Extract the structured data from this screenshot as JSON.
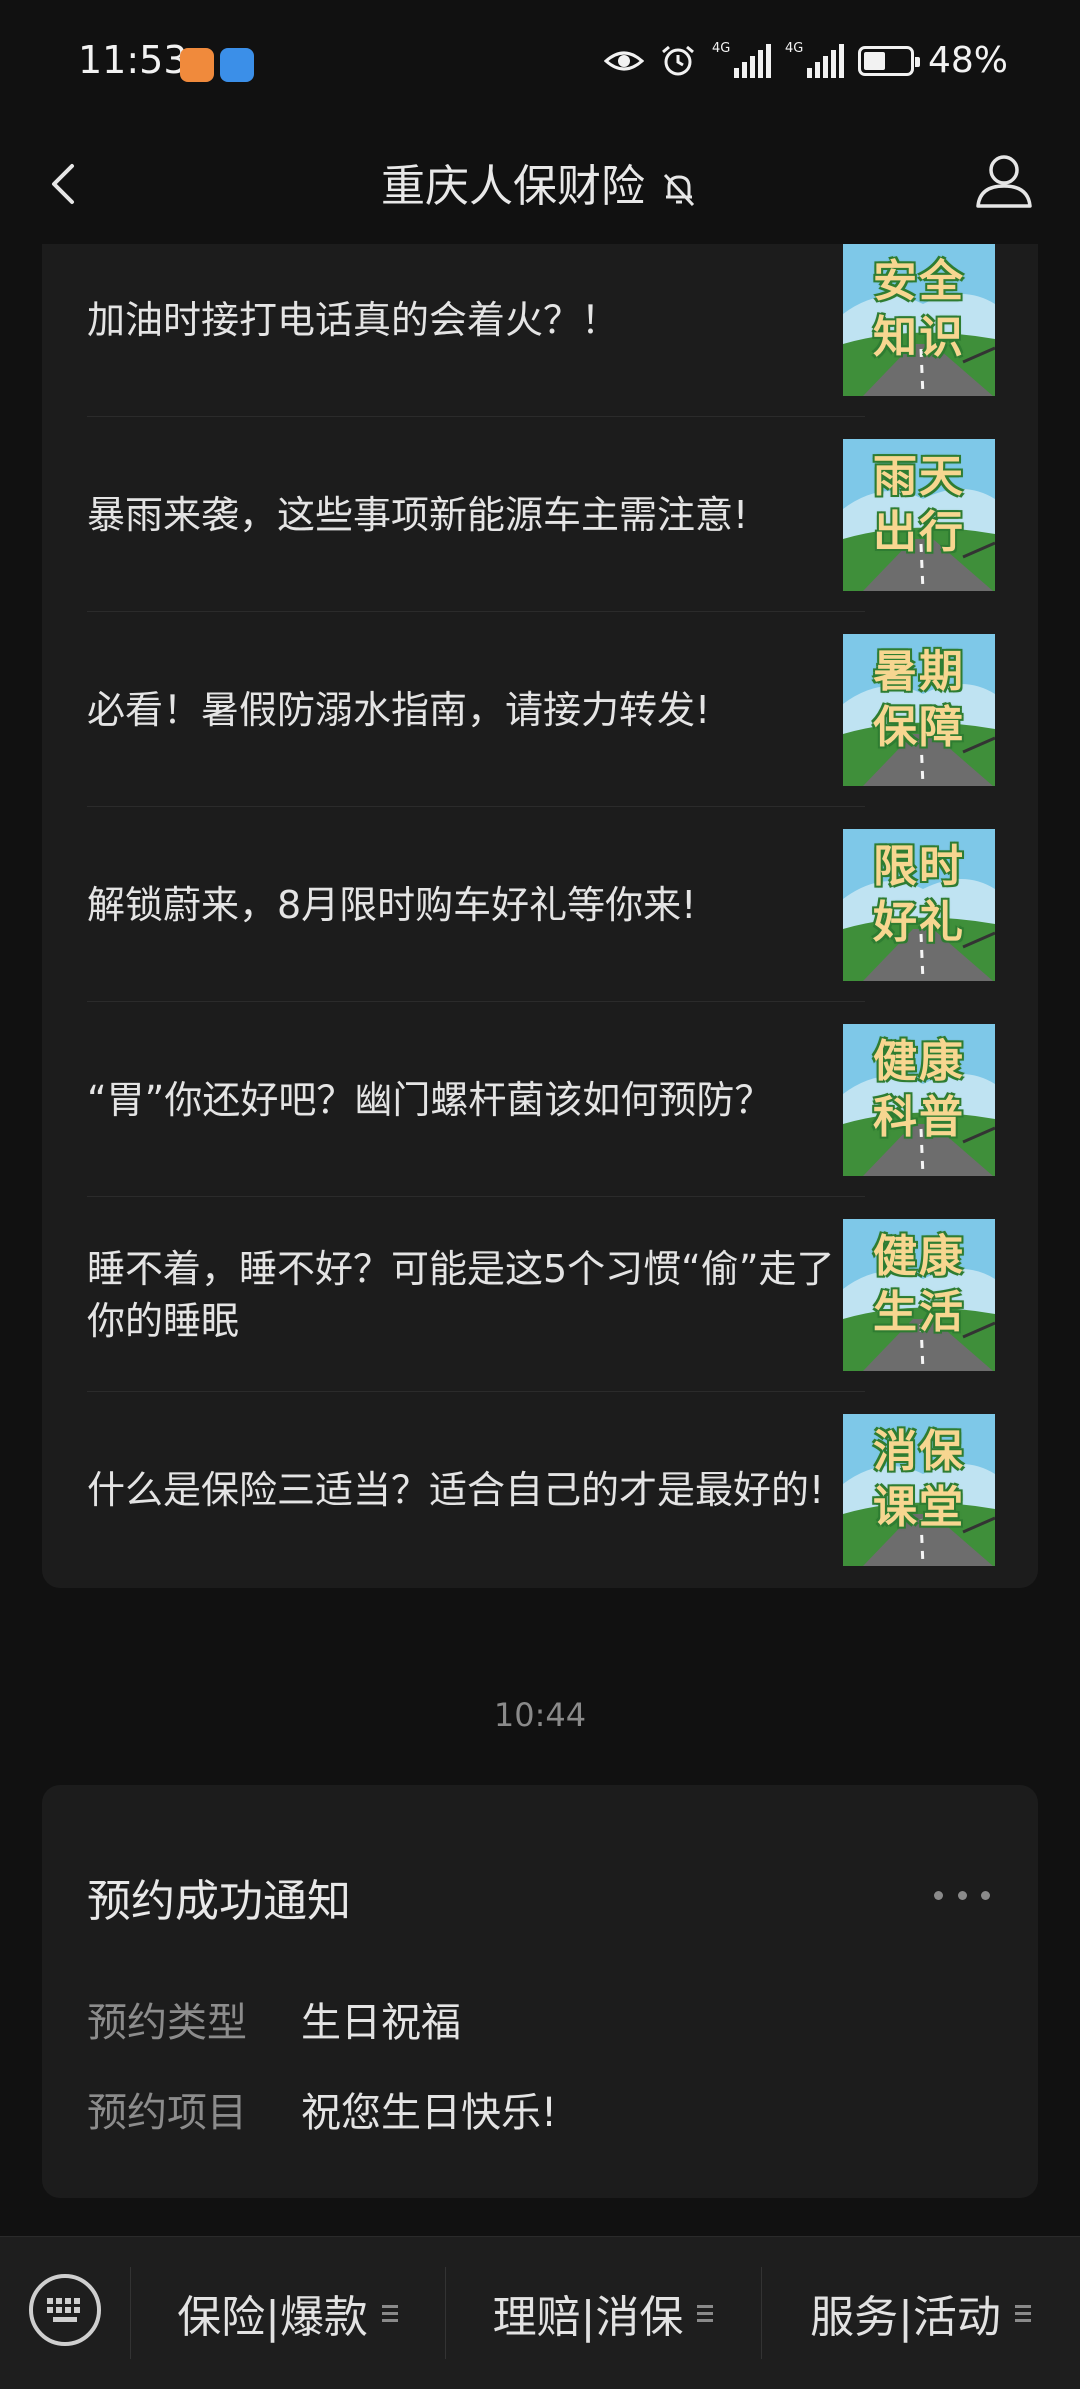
{
  "status_bar": {
    "time": "11:53",
    "network_1": "4G",
    "network_2": "4G",
    "battery": "48%",
    "battery_level": 0.48
  },
  "header": {
    "title": "重庆人保财险",
    "back_icon": "chevron-left-icon",
    "mute_icon": "bell-off-icon",
    "profile_icon": "person-icon"
  },
  "articles": [
    {
      "title": "加油时接打电话真的会着火？！",
      "thumb_label": "安全知识"
    },
    {
      "title": "暴雨来袭，这些事项新能源车主需注意!",
      "thumb_label": "雨天出行"
    },
    {
      "title": "必看！暑假防溺水指南，请接力转发!",
      "thumb_label": "暑期保障"
    },
    {
      "title": "解锁蔚来，8月限时购车好礼等你来!",
      "thumb_label": "限时好礼"
    },
    {
      "title": "“胃”你还好吧？幽门螺杆菌该如何预防？",
      "thumb_label": "健康科普"
    },
    {
      "title": "睡不着，睡不好？可能是这5个习惯“偷”走了你的睡眠",
      "thumb_label": "健康生活"
    },
    {
      "title": "什么是保险三适当？适合自己的才是最好的!",
      "thumb_label": "消保课堂"
    }
  ],
  "timestamp": "10:44",
  "notice": {
    "title": "预约成功通知",
    "rows": [
      {
        "label": "预约类型",
        "value": "生日祝福"
      },
      {
        "label": "预约项目",
        "value": "祝您生日快乐!"
      }
    ]
  },
  "bottom_menu": {
    "keyboard_icon": "keyboard-icon",
    "items": [
      {
        "label": "保险|爆款"
      },
      {
        "label": "理赔|消保"
      },
      {
        "label": "服务|活动"
      }
    ]
  },
  "colors": {
    "background": "#111111",
    "card": "#1c1c1c",
    "thumb_sky": "#7ec8e8",
    "thumb_grass": "#3f8f3a",
    "thumb_text": "#f7d690"
  }
}
